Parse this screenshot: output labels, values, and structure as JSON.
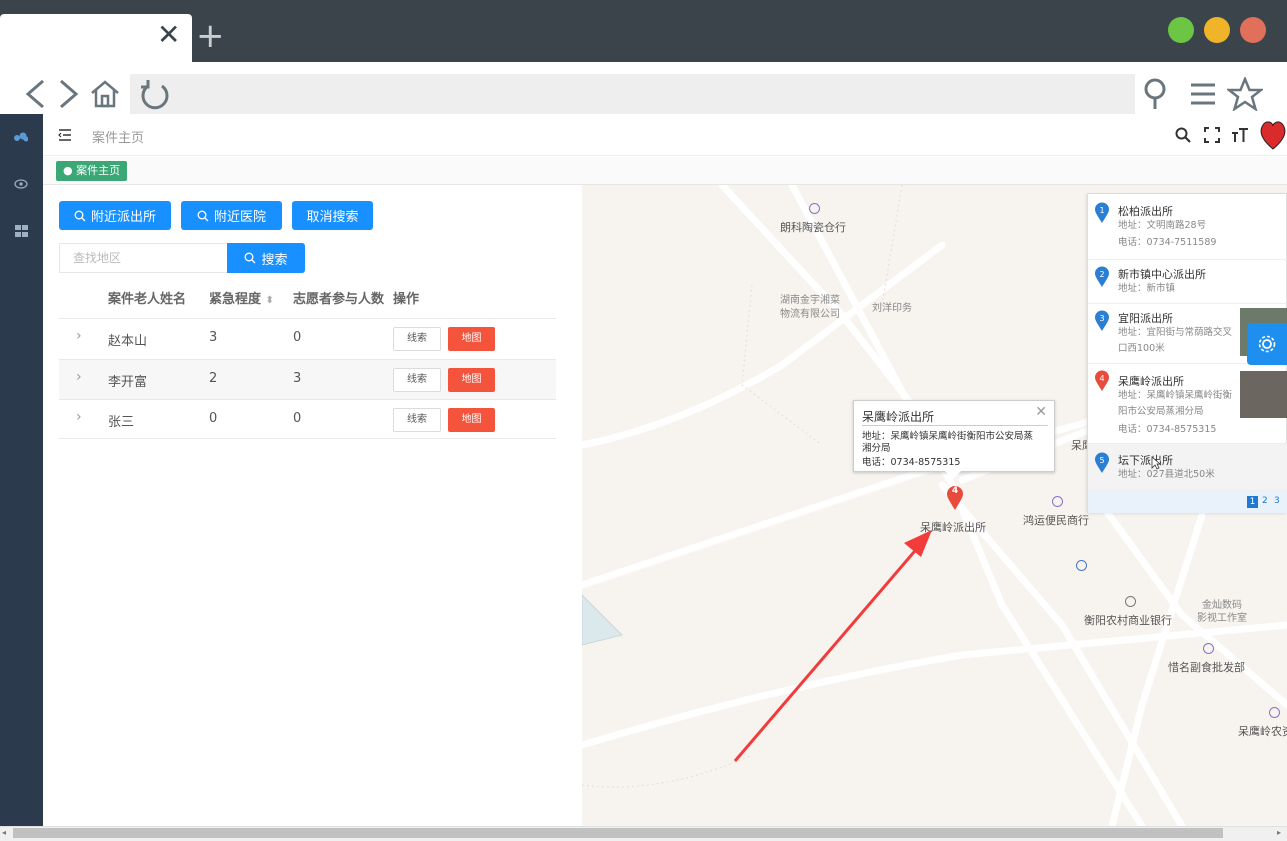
{
  "browser": {
    "tab_close_glyph": "✕",
    "tab_new_glyph": "+",
    "window_controls": {
      "green": "#6cc644",
      "yellow": "#f0b429",
      "red": "#e0705a"
    },
    "icons": [
      "back-icon",
      "forward-icon",
      "home-icon",
      "reload-icon",
      "location-icon",
      "menu-icon",
      "star-icon"
    ]
  },
  "header": {
    "breadcrumb": "案件主页",
    "tag": "案件主页",
    "icons": [
      "menu-toggle-icon",
      "search-icon",
      "fullscreen-icon",
      "font-size-icon",
      "heart-avatar"
    ]
  },
  "toolbar": {
    "nearby_police": "附近派出所",
    "nearby_hospital": "附近医院",
    "cancel_search": "取消搜索",
    "search_placeholder": "查找地区",
    "search_button": "搜索"
  },
  "table": {
    "headers": [
      "案件老人姓名",
      "紧急程度",
      "志愿者参与人数",
      "操作"
    ],
    "rows": [
      {
        "name": "赵本山",
        "urgency": "3",
        "volunteers": "0"
      },
      {
        "name": "李开富",
        "urgency": "2",
        "volunteers": "3"
      },
      {
        "name": "张三",
        "urgency": "0",
        "volunteers": "0"
      }
    ],
    "clue_label": "线索",
    "map_label": "地图"
  },
  "map": {
    "pois": {
      "p1": "朗科陶瓷仓行",
      "p2a": "湖南金宇湘菜",
      "p2b": "物流有限公司",
      "p3": "刘洋印务",
      "p4": "呆鹰岭派出所",
      "p5": "鸿运便民商行",
      "p6": "衡阳农村商业银行",
      "p7a": "金灿数码",
      "p7b": "影视工作室",
      "p8": "惜名副食批发部",
      "p9": "呆鹰岭农资",
      "p10": "呆鹰"
    },
    "marker_number": "4",
    "popup": {
      "title": "呆鹰岭派出所",
      "address": "地址：呆鹰岭镇呆鹰岭街衡阳市公安局蒸湘分局",
      "phone": "电话：0734-8575315"
    },
    "results": [
      {
        "num": "1",
        "name": "松柏派出所",
        "addr": "地址：文明南路28号",
        "tel": "电话：0734-7511589",
        "color": "#2a7fd4"
      },
      {
        "num": "2",
        "name": "新市镇中心派出所",
        "addr": "地址：新市镇",
        "tel": "",
        "color": "#2a7fd4"
      },
      {
        "num": "3",
        "name": "宜阳派出所",
        "addr": "地址：宜阳街与常荫路交叉口西100米",
        "tel": "",
        "color": "#2a7fd4"
      },
      {
        "num": "4",
        "name": "呆鹰岭派出所",
        "addr": "地址：呆鹰岭镇呆鹰岭街衡阳市公安局蒸湘分局",
        "tel": "电话：0734-8575315",
        "color": "#e84a3c"
      },
      {
        "num": "5",
        "name": "坛下派出所",
        "addr": "地址：027县道北50米",
        "tel": "",
        "color": "#2a7fd4"
      }
    ],
    "pages": [
      "1",
      "2",
      "3"
    ]
  }
}
